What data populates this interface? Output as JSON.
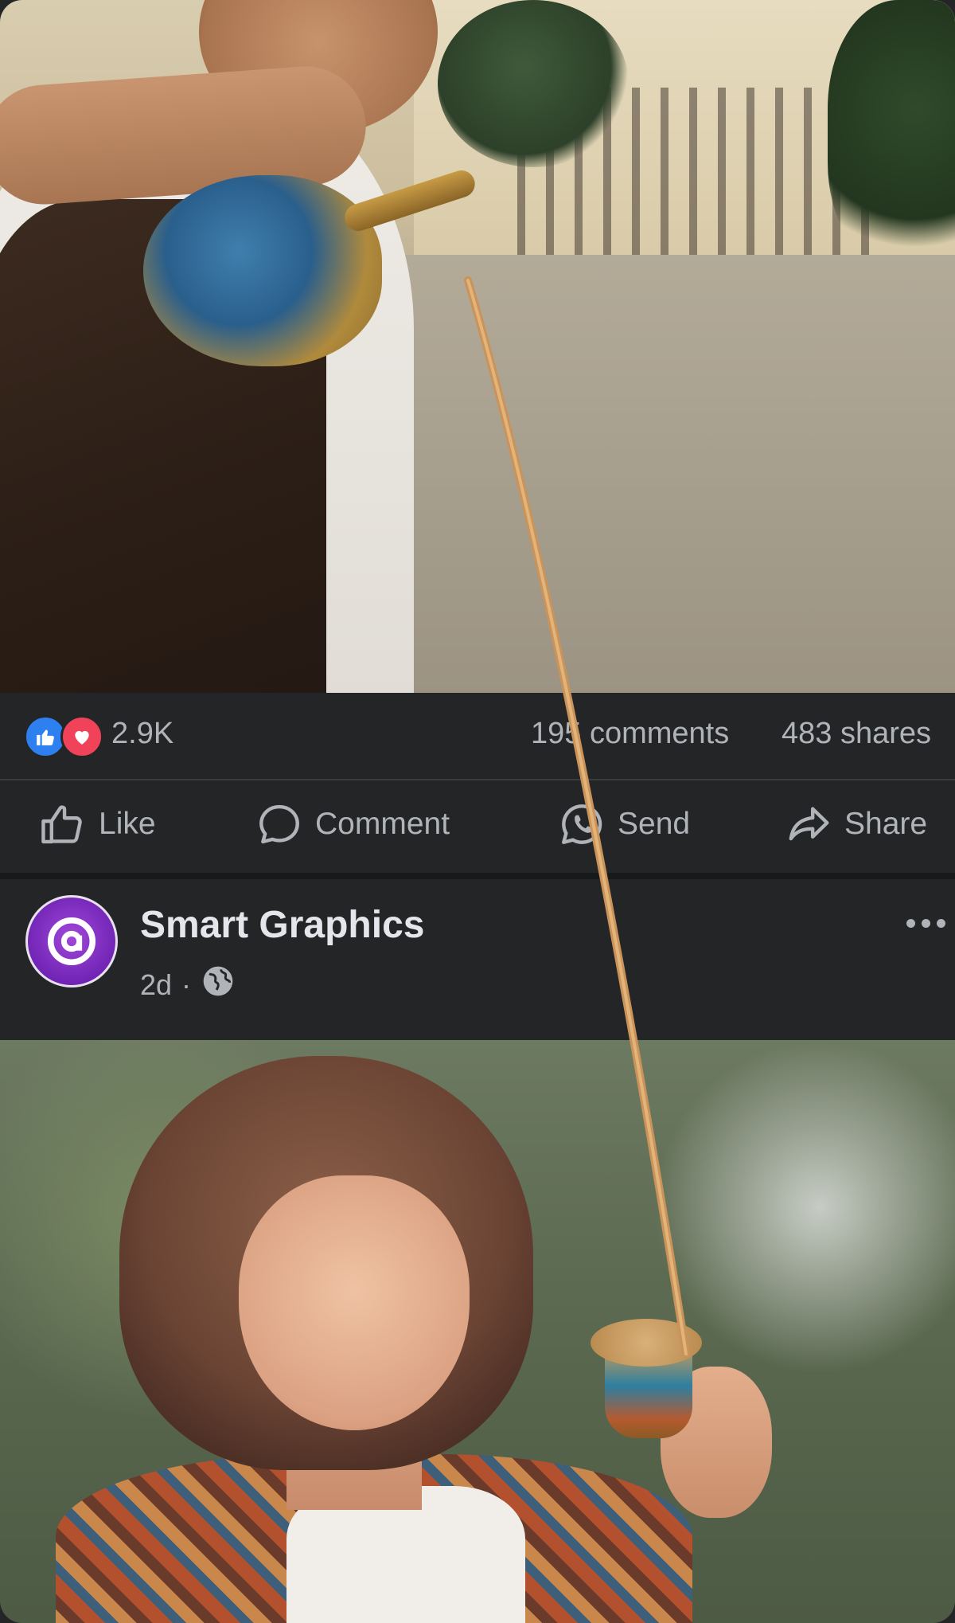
{
  "post_stats": {
    "reaction_count": "2.9K",
    "comments": "195 comments",
    "shares": "483 shares"
  },
  "actions": {
    "like": "Like",
    "comment": "Comment",
    "send": "Send",
    "share": "Share"
  },
  "next_post": {
    "author": "Smart Graphics",
    "time": "2d",
    "separator": "·",
    "privacy_icon": "globe-icon"
  },
  "icons": [
    "like-reaction-icon",
    "love-reaction-icon",
    "thumbs-up-icon",
    "comment-bubble-icon",
    "whatsapp-icon",
    "share-arrow-icon",
    "more-options-icon"
  ],
  "colors": {
    "background": "#242526",
    "text_secondary": "#b0b3b8",
    "text_primary": "#e4e6eb",
    "like_blue": "#2e80f0",
    "love_red": "#f0435a",
    "avatar_purple": "#8a33c9"
  }
}
